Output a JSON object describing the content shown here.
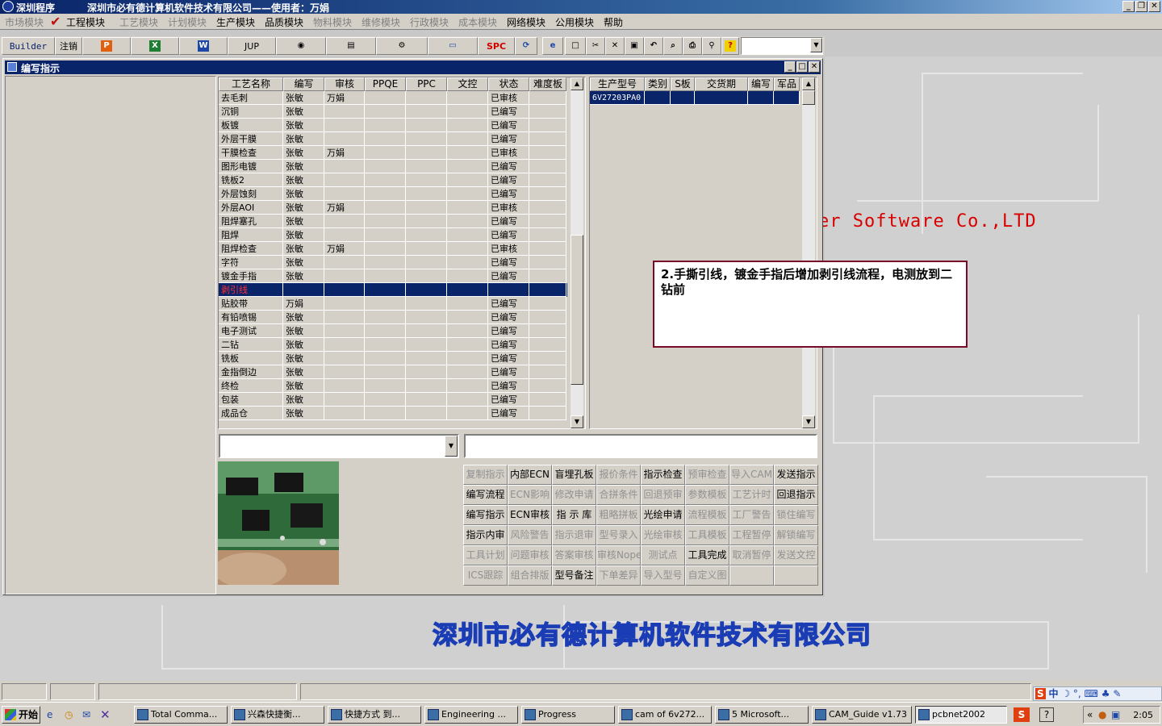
{
  "app": {
    "title": "深圳程序",
    "company_title": "深圳市必有德计算机软件技术有限公司——使用者：万娟",
    "window_controls": [
      "minimize-icon",
      "restore-icon",
      "close-icon"
    ]
  },
  "menu": [
    {
      "label": "市场模块",
      "enabled": false
    },
    {
      "label": "工程模块",
      "enabled": true,
      "checked": true
    },
    {
      "label": "工艺模块",
      "enabled": false
    },
    {
      "label": "计划模块",
      "enabled": false
    },
    {
      "label": "生产模块",
      "enabled": true
    },
    {
      "label": "品质模块",
      "enabled": true
    },
    {
      "label": "物料模块",
      "enabled": false
    },
    {
      "label": "维修模块",
      "enabled": false
    },
    {
      "label": "行政模块",
      "enabled": false
    },
    {
      "label": "成本模块",
      "enabled": false
    },
    {
      "label": "网络模块",
      "enabled": true
    },
    {
      "label": "公用模块",
      "enabled": true
    },
    {
      "label": "帮助",
      "enabled": true
    }
  ],
  "toolbar": {
    "builder_label": "Builder",
    "logout_label": "注销",
    "jup_label": "JUP",
    "spc_label": "SPC",
    "word_label": "W",
    "icons": [
      "ppt-icon",
      "excel-icon",
      "word-icon",
      "eye-icon",
      "database-icon",
      "network-icon",
      "computer-icon",
      "refresh-icon",
      "ie-icon",
      "new-icon",
      "cut-icon",
      "delete-icon",
      "save-icon",
      "undo-icon",
      "preview-icon",
      "print-icon",
      "find-icon",
      "help-icon"
    ]
  },
  "child_window": {
    "title": "编写指示"
  },
  "process_table": {
    "columns": [
      "工艺名称",
      "编写",
      "审核",
      "PPQE",
      "PPC",
      "文控",
      "状态",
      "难度板"
    ],
    "rows": [
      [
        "去毛刺",
        "张敏",
        "万娟",
        "",
        "",
        "",
        "已审核",
        ""
      ],
      [
        "沉铜",
        "张敏",
        "",
        "",
        "",
        "",
        "已编写",
        ""
      ],
      [
        "板镀",
        "张敏",
        "",
        "",
        "",
        "",
        "已编写",
        ""
      ],
      [
        "外层干膜",
        "张敏",
        "",
        "",
        "",
        "",
        "已编写",
        ""
      ],
      [
        "干膜检查",
        "张敏",
        "万娟",
        "",
        "",
        "",
        "已审核",
        ""
      ],
      [
        "图形电镀",
        "张敏",
        "",
        "",
        "",
        "",
        "已编写",
        ""
      ],
      [
        "铣板2",
        "张敏",
        "",
        "",
        "",
        "",
        "已编写",
        ""
      ],
      [
        "外层蚀刻",
        "张敏",
        "",
        "",
        "",
        "",
        "已编写",
        ""
      ],
      [
        "外层AOI",
        "张敏",
        "万娟",
        "",
        "",
        "",
        "已审核",
        ""
      ],
      [
        "阻焊塞孔",
        "张敏",
        "",
        "",
        "",
        "",
        "已编写",
        ""
      ],
      [
        "阻焊",
        "张敏",
        "",
        "",
        "",
        "",
        "已编写",
        ""
      ],
      [
        "阻焊检查",
        "张敏",
        "万娟",
        "",
        "",
        "",
        "已审核",
        ""
      ],
      [
        "字符",
        "张敏",
        "",
        "",
        "",
        "",
        "已编写",
        ""
      ],
      [
        "镀金手指",
        "张敏",
        "",
        "",
        "",
        "",
        "已编写",
        ""
      ],
      [
        "剥引线",
        "",
        "",
        "",
        "",
        "",
        "",
        ""
      ],
      [
        "贴胶带",
        "万娟",
        "",
        "",
        "",
        "",
        "已编写",
        ""
      ],
      [
        "有铅喷锡",
        "张敏",
        "",
        "",
        "",
        "",
        "已编写",
        ""
      ],
      [
        "电子测试",
        "张敏",
        "",
        "",
        "",
        "",
        "已编写",
        ""
      ],
      [
        "二钻",
        "张敏",
        "",
        "",
        "",
        "",
        "已编写",
        ""
      ],
      [
        "铣板",
        "张敏",
        "",
        "",
        "",
        "",
        "已编写",
        ""
      ],
      [
        "金指倒边",
        "张敏",
        "",
        "",
        "",
        "",
        "已编写",
        ""
      ],
      [
        "终检",
        "张敏",
        "",
        "",
        "",
        "",
        "已编写",
        ""
      ],
      [
        "包装",
        "张敏",
        "",
        "",
        "",
        "",
        "已编写",
        ""
      ],
      [
        "成品仓",
        "张敏",
        "",
        "",
        "",
        "",
        "已编写",
        ""
      ]
    ],
    "selected_index": 14
  },
  "model_table": {
    "columns": [
      "生产型号",
      "类别",
      "S板",
      "交货期",
      "编写",
      "军品"
    ],
    "rows": [
      [
        "6V27203PA0",
        "",
        "",
        "",
        "",
        ""
      ]
    ]
  },
  "inputs": {
    "combo_value": "",
    "text_value": ""
  },
  "buttons": [
    [
      {
        "label": "复制指示",
        "enabled": false
      },
      {
        "label": "内部ECN",
        "enabled": true
      },
      {
        "label": "盲埋孔板",
        "enabled": true
      },
      {
        "label": "报价条件",
        "enabled": false
      },
      {
        "label": "指示检查",
        "enabled": true
      },
      {
        "label": "预审检查",
        "enabled": false
      },
      {
        "label": "导入CAM",
        "enabled": false
      },
      {
        "label": "发送指示",
        "enabled": true
      }
    ],
    [
      {
        "label": "编写流程",
        "enabled": true
      },
      {
        "label": "ECN影响",
        "enabled": false
      },
      {
        "label": "修改申请",
        "enabled": false
      },
      {
        "label": "合拼条件",
        "enabled": false
      },
      {
        "label": "回退预审",
        "enabled": false
      },
      {
        "label": "参数模板",
        "enabled": false
      },
      {
        "label": "工艺计时",
        "enabled": false
      },
      {
        "label": "回退指示",
        "enabled": true
      }
    ],
    [
      {
        "label": "编写指示",
        "enabled": true
      },
      {
        "label": "ECN审核",
        "enabled": true
      },
      {
        "label": "指 示 库",
        "enabled": true
      },
      {
        "label": "粗略拼板",
        "enabled": false
      },
      {
        "label": "光绘申请",
        "enabled": true
      },
      {
        "label": "流程模板",
        "enabled": false
      },
      {
        "label": "工厂警告",
        "enabled": false
      },
      {
        "label": "锁住编写",
        "enabled": false
      }
    ],
    [
      {
        "label": "指示内审",
        "enabled": true
      },
      {
        "label": "风险警告",
        "enabled": false
      },
      {
        "label": "指示退审",
        "enabled": false
      },
      {
        "label": "型号录入",
        "enabled": false
      },
      {
        "label": "光绘审核",
        "enabled": false
      },
      {
        "label": "工具模板",
        "enabled": false
      },
      {
        "label": "工程暂停",
        "enabled": false
      },
      {
        "label": "解锁编写",
        "enabled": false
      }
    ],
    [
      {
        "label": "工具计划",
        "enabled": false
      },
      {
        "label": "问题审核",
        "enabled": false
      },
      {
        "label": "答案审核",
        "enabled": false
      },
      {
        "label": "审核Nope",
        "enabled": false
      },
      {
        "label": "测试点",
        "enabled": false
      },
      {
        "label": "工具完成",
        "enabled": true
      },
      {
        "label": "取消暂停",
        "enabled": false
      },
      {
        "label": "发送文控",
        "enabled": false
      }
    ],
    [
      {
        "label": "ICS跟踪",
        "enabled": false
      },
      {
        "label": "组合排版",
        "enabled": false
      },
      {
        "label": "型号备注",
        "enabled": true
      },
      {
        "label": "下单差异",
        "enabled": false
      },
      {
        "label": "导入型号",
        "enabled": false
      },
      {
        "label": "自定义图",
        "enabled": false
      },
      {
        "label": "",
        "enabled": false
      },
      {
        "label": "",
        "enabled": false
      }
    ]
  ],
  "popup_note": {
    "text": "2.手撕引线，镀金手指后增加剥引线流程，电测放到二钻前"
  },
  "background": {
    "slogan": "er Software Co.,LTD",
    "company_name": "深圳市必有德计算机软件技术有限公司"
  },
  "taskbar": {
    "start_label": "开始",
    "tasks": [
      {
        "label": "Total Comma...",
        "active": false
      },
      {
        "label": "兴森快捷衡...",
        "active": false
      },
      {
        "label": "快捷方式 到...",
        "active": false
      },
      {
        "label": "Engineering ...",
        "active": false
      },
      {
        "label": "Progress",
        "active": false
      },
      {
        "label": "cam of 6v272...",
        "active": false
      },
      {
        "label": "5 Microsoft...",
        "active": false
      },
      {
        "label": "CAM_Guide v1.73",
        "active": false
      },
      {
        "label": "pcbnet2002",
        "active": true
      }
    ],
    "clock": "2:05",
    "ime_label": "中"
  }
}
